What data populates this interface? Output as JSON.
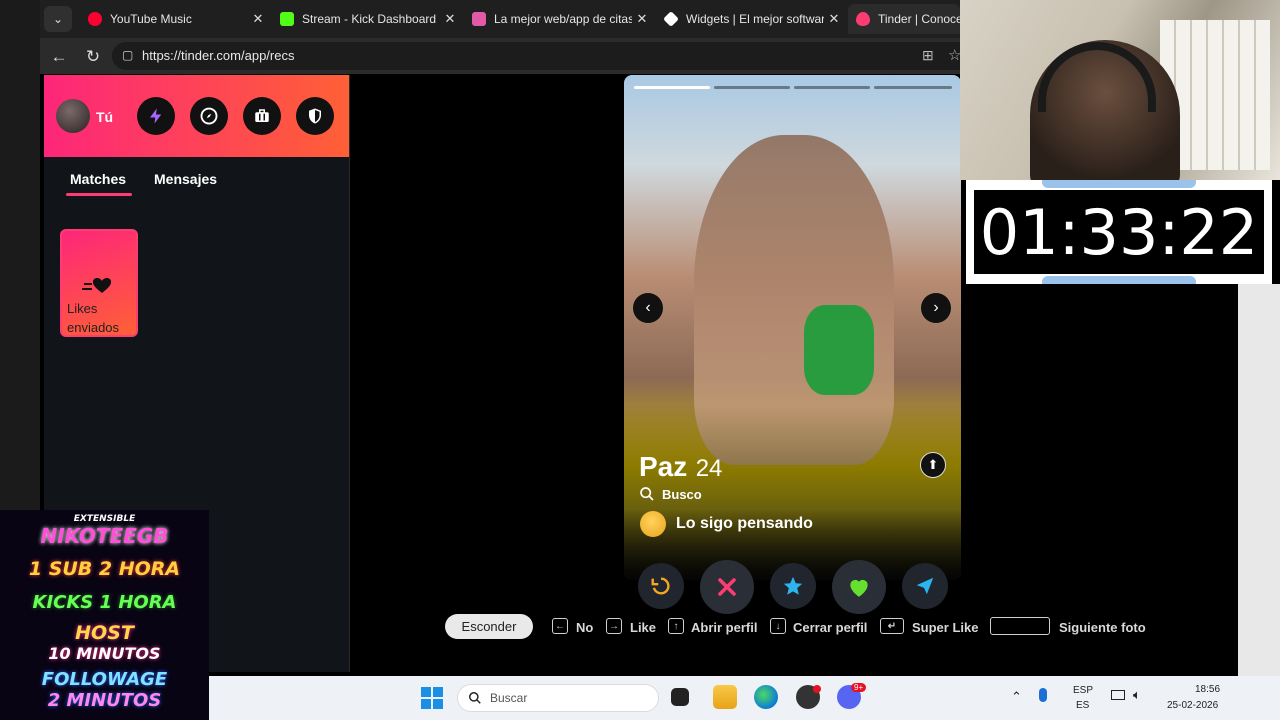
{
  "browser": {
    "tabs": [
      {
        "title": "YouTube Music",
        "favicon_color": "#ff0033"
      },
      {
        "title": "Stream - Kick Dashboard",
        "favicon_color": "#53fc18"
      },
      {
        "title": "La mejor web/app de citas g",
        "favicon_color": "#e05aa6"
      },
      {
        "title": "Widgets | El mejor software",
        "favicon_color": "#ffffff"
      },
      {
        "title": "Tinder | Conoce",
        "favicon_color": "#fe3c72"
      }
    ],
    "url": "https://tinder.com/app/recs"
  },
  "sidebar": {
    "user_label": "Tú",
    "tabs": [
      {
        "label": "Matches"
      },
      {
        "label": "Mensajes"
      }
    ],
    "likes_card_label": "Likes enviados"
  },
  "profile": {
    "name": "Paz",
    "age": "24",
    "looking_label": "Busco",
    "looking_value": "Lo sigo pensando",
    "photo_count": 4,
    "current_photo": 1
  },
  "actions": [
    {
      "name": "rewind",
      "icon": "rewind-icon",
      "color": "#f5a623"
    },
    {
      "name": "nope",
      "icon": "x-icon",
      "color": "#fe3c72"
    },
    {
      "name": "super-like",
      "icon": "star-icon",
      "color": "#2db5f0"
    },
    {
      "name": "like",
      "icon": "heart-icon",
      "color": "#65e02f"
    },
    {
      "name": "boost",
      "icon": "send-icon",
      "color": "#2ab4f2"
    }
  ],
  "shortcuts": {
    "hide_label": "Esconder",
    "items": [
      {
        "label": "No"
      },
      {
        "label": "Like"
      },
      {
        "label": "Abrir perfil"
      },
      {
        "label": "Cerrar perfil"
      },
      {
        "label": "Super Like"
      },
      {
        "label": "Siguiente foto"
      }
    ]
  },
  "timer": {
    "value": "01:33:22"
  },
  "promo": {
    "lines": [
      {
        "text": "EXTENSIBLE",
        "color": "#ffffff"
      },
      {
        "text": "NIKOTEEGB",
        "color": "#ff4fd8"
      },
      {
        "text": "1 SUB 2 HORA",
        "color": "#ffd23c"
      },
      {
        "text": "KICKS 1 HORA",
        "color": "#66ff55"
      },
      {
        "text": "HOST",
        "color": "#ffd84a"
      },
      {
        "text": "10 MINUTOS",
        "color": "#ffffff"
      },
      {
        "text": "FOLLOWAGE",
        "color": "#7fe3ff"
      },
      {
        "text": "2 MINUTOS",
        "color": "#ff8ae6"
      }
    ]
  },
  "taskbar": {
    "search_placeholder": "Buscar",
    "language": "ESP",
    "layout": "ES",
    "time": "18:56",
    "date": "25-02-2026",
    "discord_badge": "9+"
  }
}
